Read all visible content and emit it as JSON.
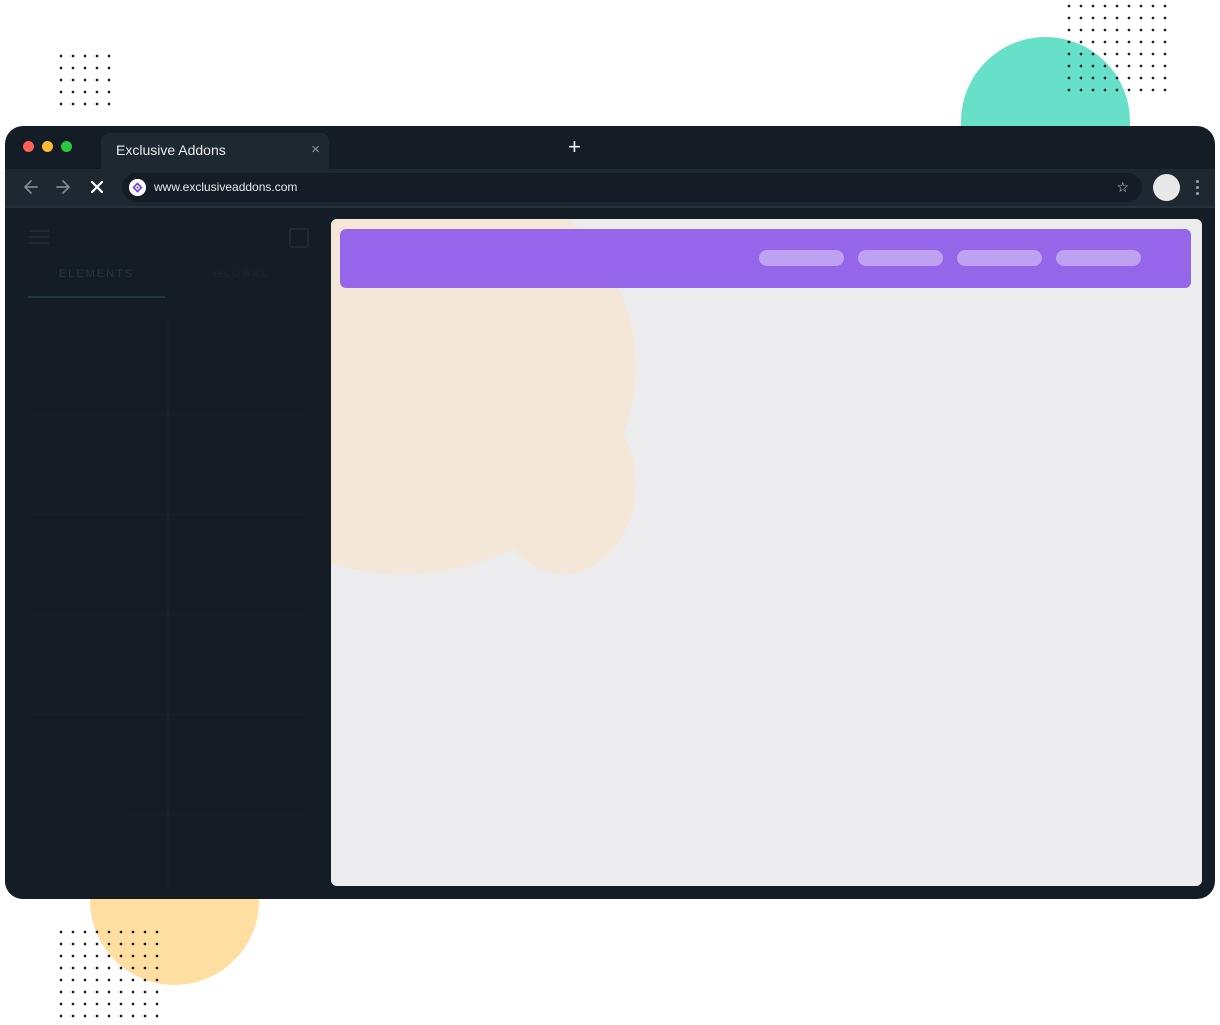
{
  "browser": {
    "tab": {
      "title": "Exclusive Addons",
      "close_glyph": "×"
    },
    "new_tab_glyph": "+",
    "toolbar": {
      "back_icon": "arrow-left-icon",
      "forward_icon": "arrow-right-icon",
      "stop_icon": "close-icon",
      "url": "www.exclusiveaddons.com",
      "bookmark_glyph": "☆",
      "avatar_icon": "profile-avatar",
      "menu_icon": "kebab-menu-icon"
    },
    "window_controls": [
      "close",
      "minimize",
      "maximize"
    ]
  },
  "editor_panel": {
    "tabs": [
      {
        "label": "ELEMENTS"
      },
      {
        "label": "GLOBAL"
      }
    ]
  },
  "preview": {
    "header_color": "#9566ea",
    "nav_pill_count": 4
  },
  "colors": {
    "accent_purple": "#9566ea",
    "teal_decor": "#66e0c9",
    "yellow_decor": "#ffdea2",
    "window_bg": "#141d26"
  }
}
